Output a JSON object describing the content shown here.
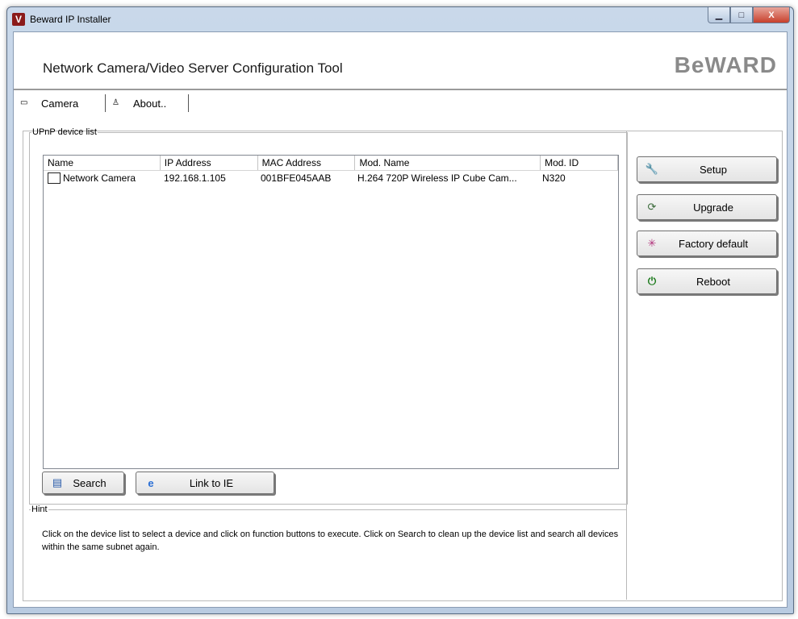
{
  "window": {
    "title": "Beward IP Installer",
    "minimize_glyph": "▁",
    "maximize_glyph": "□",
    "close_glyph": "X"
  },
  "header": {
    "heading": "Network Camera/Video Server Configuration Tool",
    "logo_text": "BeWARD"
  },
  "tabs": [
    {
      "label": "Camera",
      "icon": "camera-icon"
    },
    {
      "label": "About..",
      "icon": "person-icon"
    }
  ],
  "device_list": {
    "group_label": "UPnP device list",
    "columns": [
      "Name",
      "IP Address",
      "MAC Address",
      "Mod. Name",
      "Mod. ID"
    ],
    "rows": [
      {
        "name": "Network Camera",
        "ip": "192.168.1.105",
        "mac": "001BFE045AAB",
        "model_name": "H.264 720P Wireless IP Cube Cam...",
        "model_id": "N320"
      }
    ]
  },
  "buttons": {
    "setup": "Setup",
    "upgrade": "Upgrade",
    "factory_default": "Factory default",
    "reboot": "Reboot",
    "search": "Search",
    "link_to_ie": "Link to IE"
  },
  "hint": {
    "group_label": "Hint",
    "text": "Click on the device list to select a device and click on function buttons to execute. Click on Search to clean up the device list and search all devices  within the same subnet again."
  },
  "colors": {
    "titlebar": "#c9d8ea",
    "close_button": "#c7402c",
    "logo": "#8a8a8a",
    "brand_icon": "#8b1a1a"
  }
}
